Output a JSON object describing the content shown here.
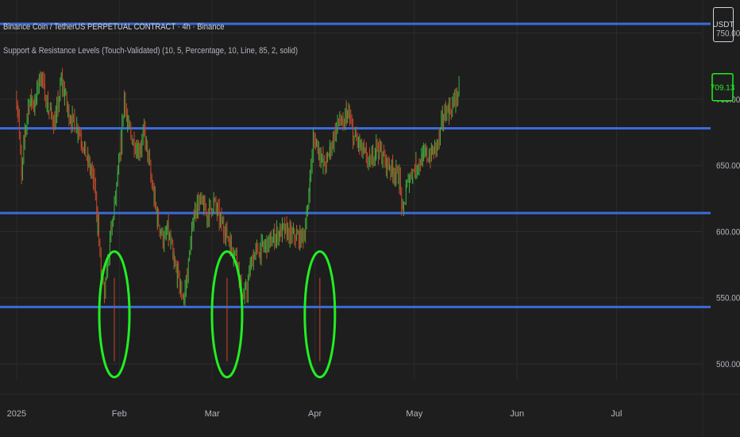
{
  "header": {
    "title": "Binance Coin / TetherUS PERPETUAL CONTRACT · 4h · Binance",
    "indicator": "Support & Resistance Levels (Touch-Validated) (10, 5, Percentage, 10, Line, 85, 2, solid)",
    "unit_badge": "USDT"
  },
  "chart_data": {
    "type": "line",
    "series": [
      {
        "candle_closes": [
          [
            0.0,
            700
          ],
          [
            0.5,
            690
          ],
          [
            1.5,
            640
          ],
          [
            2.5,
            675
          ],
          [
            3.5,
            695
          ],
          [
            4.5,
            700
          ],
          [
            5.5,
            695
          ],
          [
            6.5,
            712
          ],
          [
            7.5,
            718
          ],
          [
            8.5,
            705
          ],
          [
            9.5,
            693
          ],
          [
            10.5,
            688
          ],
          [
            11.5,
            682
          ],
          [
            12.5,
            696
          ],
          [
            13.5,
            714
          ],
          [
            14.5,
            704
          ],
          [
            15.5,
            691
          ],
          [
            16.5,
            685
          ],
          [
            17.5,
            681
          ],
          [
            18.5,
            678
          ],
          [
            19.5,
            671
          ],
          [
            20.5,
            662
          ],
          [
            21.5,
            653
          ],
          [
            22.5,
            645
          ],
          [
            23.5,
            636
          ],
          [
            24.5,
            606
          ],
          [
            25.5,
            568
          ],
          [
            26.5,
            552
          ],
          [
            27.5,
            575
          ],
          [
            28.5,
            600
          ],
          [
            29.5,
            620
          ],
          [
            30.5,
            640
          ],
          [
            31.5,
            665
          ],
          [
            32.5,
            705
          ],
          [
            33.5,
            680
          ],
          [
            34.5,
            672
          ],
          [
            35.5,
            668
          ],
          [
            36.5,
            662
          ],
          [
            37.5,
            665
          ],
          [
            38.5,
            675
          ],
          [
            39.5,
            660
          ],
          [
            40.5,
            640
          ],
          [
            41.5,
            625
          ],
          [
            42.5,
            610
          ],
          [
            43.5,
            600
          ],
          [
            44.5,
            592
          ],
          [
            45.5,
            601
          ],
          [
            46.5,
            590
          ],
          [
            47.5,
            575
          ],
          [
            48.5,
            568
          ],
          [
            49.5,
            555
          ],
          [
            50.5,
            550
          ],
          [
            51.5,
            568
          ],
          [
            52.5,
            590
          ],
          [
            53.5,
            612
          ],
          [
            54.5,
            620
          ],
          [
            55.5,
            622
          ],
          [
            56.5,
            618
          ],
          [
            57.5,
            612
          ],
          [
            58.5,
            618
          ],
          [
            59.5,
            622
          ],
          [
            60.5,
            615
          ],
          [
            61.5,
            608
          ],
          [
            62.5,
            603
          ],
          [
            63.5,
            598
          ],
          [
            64.5,
            590
          ],
          [
            65.5,
            585
          ],
          [
            66.5,
            582
          ],
          [
            67.5,
            560
          ],
          [
            68.5,
            550
          ],
          [
            69.5,
            556
          ],
          [
            70.5,
            572
          ],
          [
            71.5,
            583
          ],
          [
            72.5,
            585
          ],
          [
            73.5,
            586
          ],
          [
            74.5,
            588
          ],
          [
            75.5,
            590
          ],
          [
            76.5,
            592
          ],
          [
            77.5,
            595
          ],
          [
            78.5,
            598
          ],
          [
            79.5,
            600
          ],
          [
            80.5,
            601
          ],
          [
            81.5,
            600
          ],
          [
            82.5,
            598
          ],
          [
            83.5,
            597
          ],
          [
            84.5,
            597
          ],
          [
            85.5,
            595
          ],
          [
            86.5,
            597
          ],
          [
            87.5,
            610
          ],
          [
            88.5,
            640
          ],
          [
            89.5,
            670
          ],
          [
            90.5,
            667
          ],
          [
            91.5,
            660
          ],
          [
            92.5,
            650
          ],
          [
            93.5,
            652
          ],
          [
            94.5,
            662
          ],
          [
            95.5,
            670
          ],
          [
            96.5,
            678
          ],
          [
            97.5,
            685
          ],
          [
            98.5,
            678
          ],
          [
            99.5,
            690
          ],
          [
            100.5,
            685
          ],
          [
            101.5,
            672
          ],
          [
            102.5,
            670
          ],
          [
            103.5,
            665
          ],
          [
            104.5,
            660
          ],
          [
            105.5,
            657
          ],
          [
            106.5,
            652
          ],
          [
            107.5,
            658
          ],
          [
            108.5,
            665
          ],
          [
            109.5,
            662
          ],
          [
            110.5,
            656
          ],
          [
            111.5,
            652
          ],
          [
            112.5,
            650
          ],
          [
            113.5,
            647
          ],
          [
            114.5,
            643
          ],
          [
            115.5,
            640
          ],
          [
            116.5,
            613
          ],
          [
            117.5,
            632
          ],
          [
            118.5,
            640
          ],
          [
            119.5,
            645
          ],
          [
            120.5,
            650
          ],
          [
            121.5,
            653
          ],
          [
            122.5,
            655
          ],
          [
            123.5,
            658
          ],
          [
            124.5,
            657
          ],
          [
            125.5,
            660
          ],
          [
            126.5,
            664
          ],
          [
            127.5,
            670
          ],
          [
            128.5,
            685
          ],
          [
            129.5,
            690
          ],
          [
            130.5,
            692
          ],
          [
            131.5,
            695
          ],
          [
            132.5,
            700
          ],
          [
            133.5,
            709.13
          ]
        ]
      }
    ],
    "x_ticks": [
      "2025",
      "Feb",
      "Mar",
      "Apr",
      "May",
      "Jun",
      "Jul"
    ],
    "x_tick_days": [
      0,
      31,
      59,
      90,
      120,
      151,
      181
    ],
    "y_ticks": [
      "500.00",
      "550.00",
      "600.00",
      "650.00",
      "700.00",
      "750.00"
    ],
    "y_tick_values": [
      500,
      550,
      600,
      650,
      700,
      750
    ],
    "ylim": [
      488,
      775
    ],
    "xlim": [
      -5,
      207
    ],
    "levels": [
      757,
      678,
      614,
      543
    ],
    "last_price": "709.13",
    "touch_markers": [
      {
        "day": 29.5,
        "low": 490,
        "high": 585
      },
      {
        "day": 63.5,
        "low": 490,
        "high": 585
      },
      {
        "day": 91.5,
        "low": 490,
        "high": 585
      }
    ],
    "colors": {
      "up": "#3fae3f",
      "down": "#c94a2a",
      "level": "#3a6bd9",
      "marker": "#22ee22",
      "grid": "#2c2c2c",
      "axis_text": "#b2b5be"
    }
  }
}
